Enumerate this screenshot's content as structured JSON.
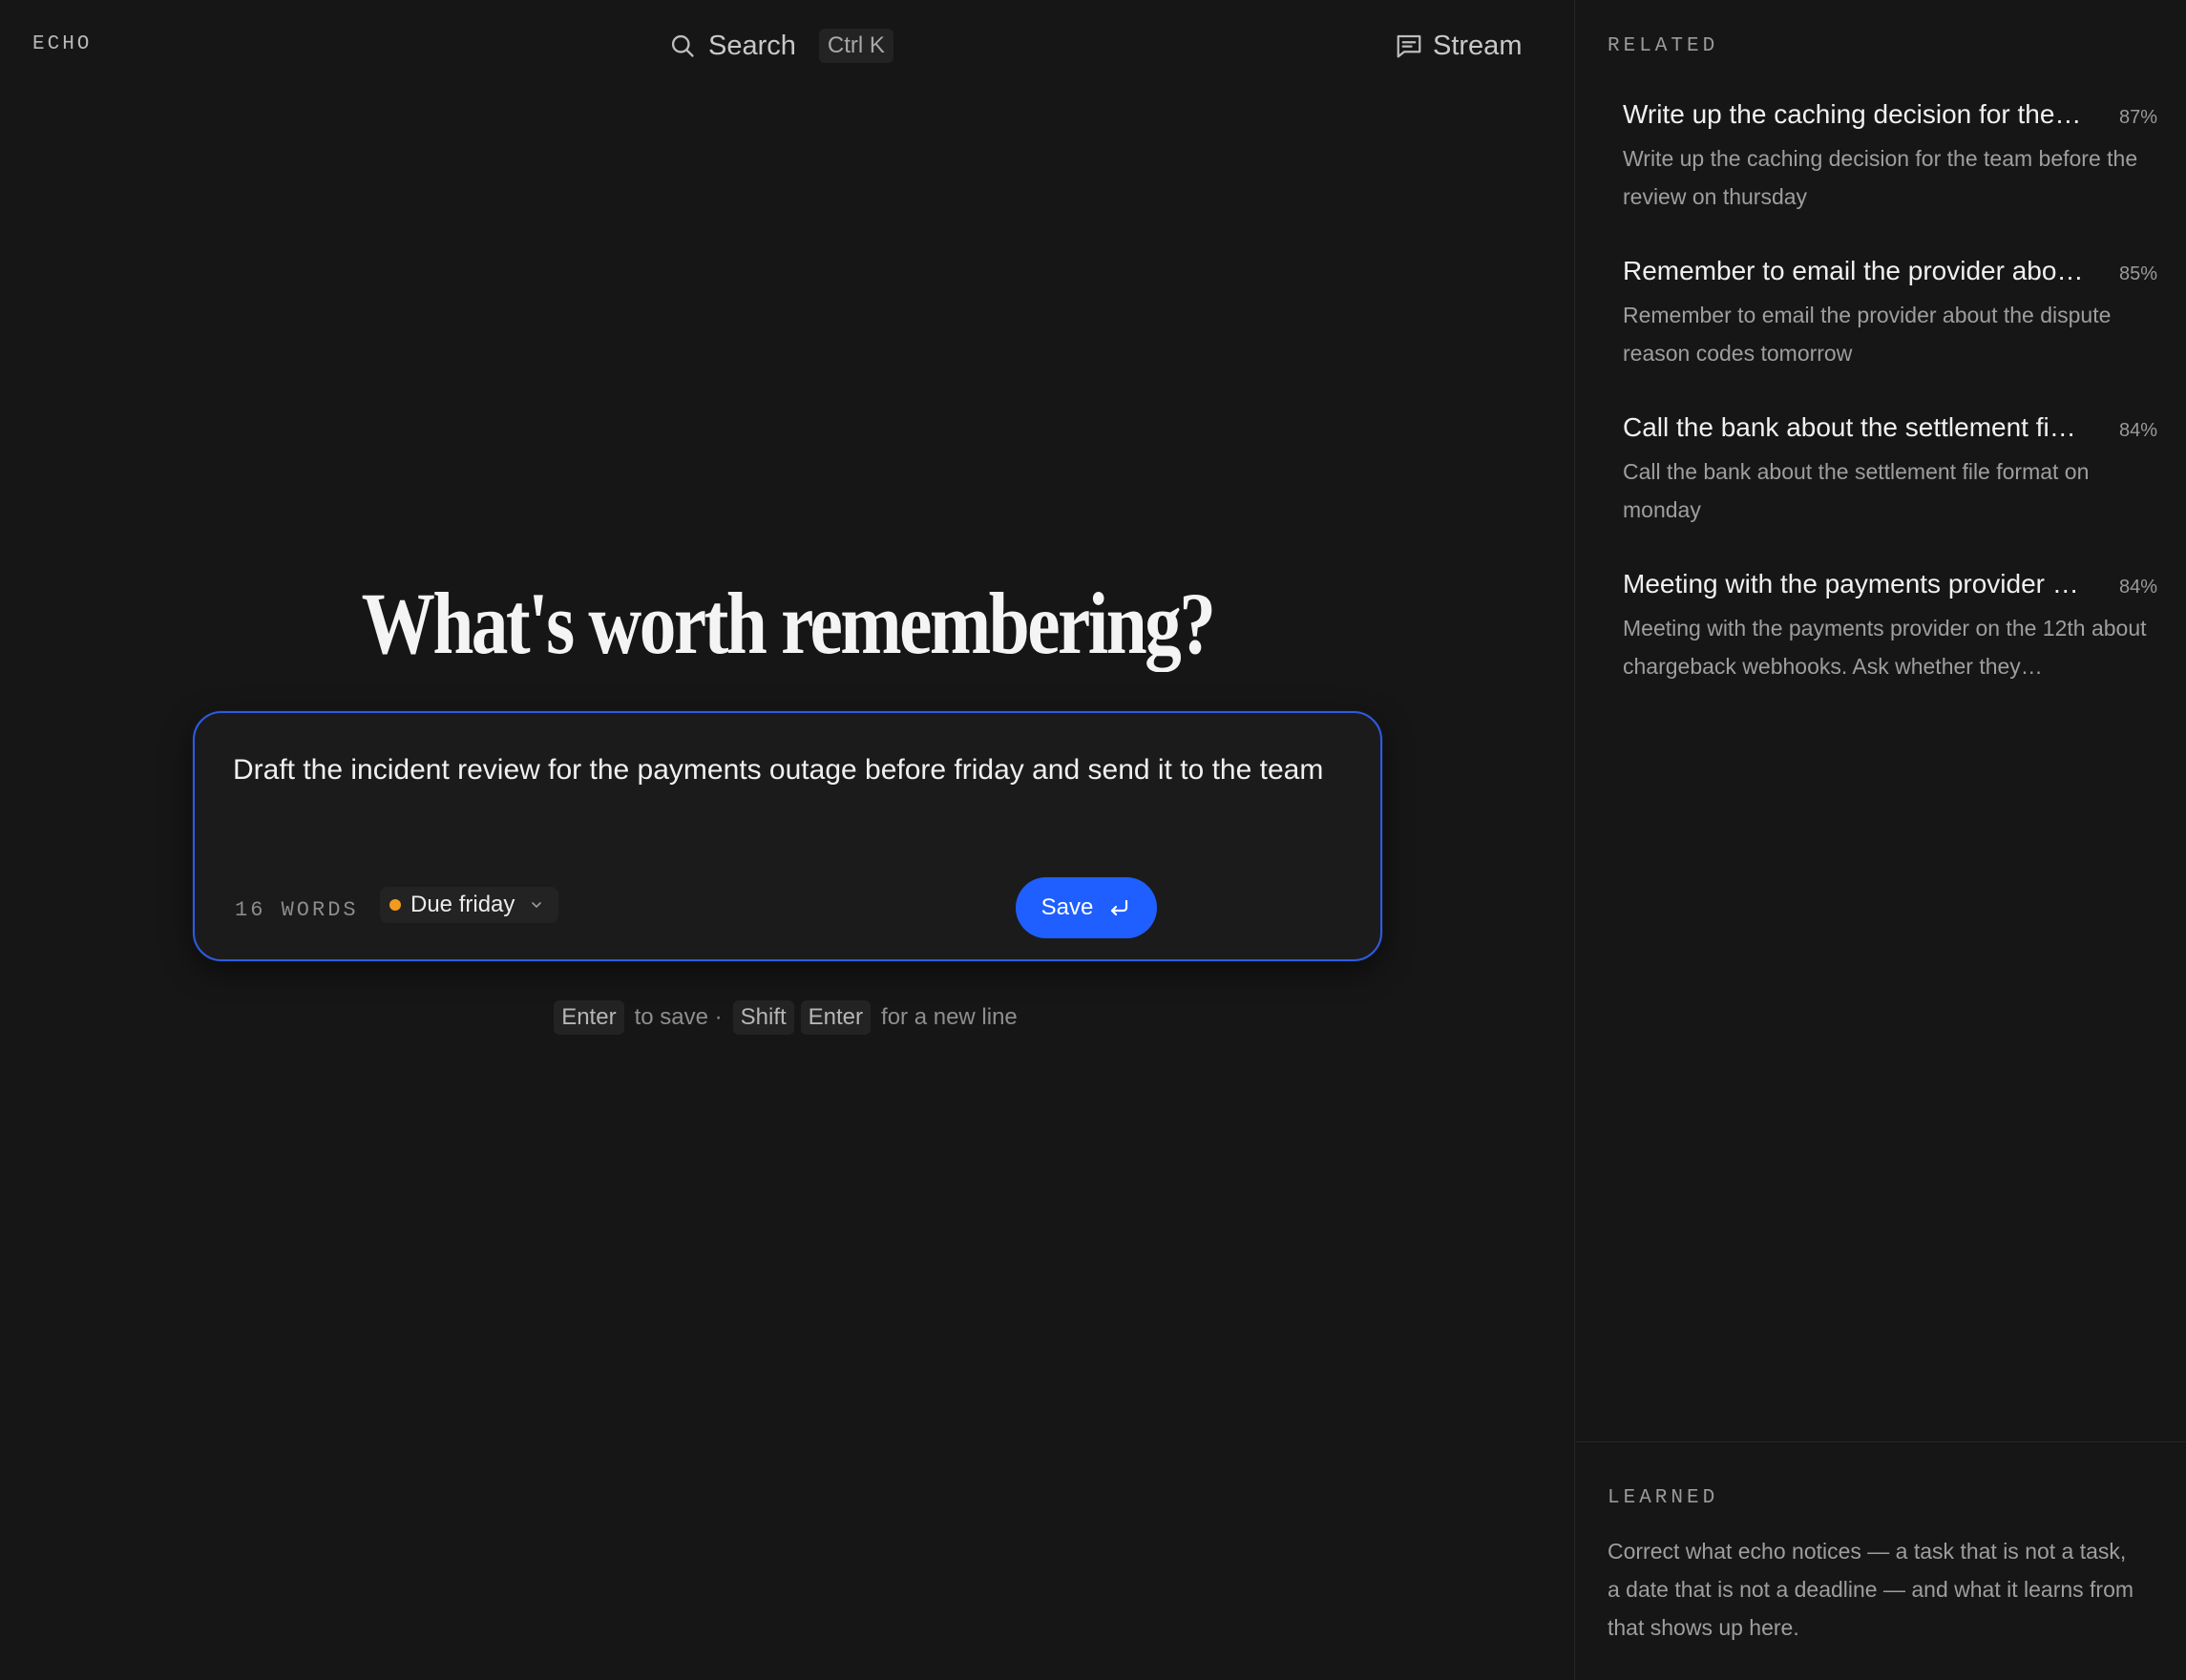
{
  "app": {
    "brand": "ECHO"
  },
  "header": {
    "search_label": "Search",
    "search_shortcut": "Ctrl K",
    "stream_label": "Stream"
  },
  "main": {
    "headline": "What's worth remembering?",
    "composer": {
      "text": "Draft the incident review for the payments outage before friday and send it to the team",
      "word_count": "16 WORDS",
      "due_label": "Due friday",
      "due_color": "#f29a1f",
      "save_label": "Save"
    },
    "hints": {
      "key_enter": "Enter",
      "to_save": "to save ·",
      "key_shift": "Shift",
      "key_enter2": "Enter",
      "new_line": "for a new line"
    }
  },
  "sidebar": {
    "related_title": "RELATED",
    "related": [
      {
        "title": "Write up the caching decision for the…",
        "score": "87%",
        "body": "Write up the caching decision for the team before the review on thursday"
      },
      {
        "title": "Remember to email the provider abo…",
        "score": "85%",
        "body": "Remember to email the provider about the dispute reason codes tomorrow"
      },
      {
        "title": "Call the bank about the settlement fi…",
        "score": "84%",
        "body": "Call the bank about the settlement file format on monday"
      },
      {
        "title": "Meeting with the payments provider …",
        "score": "84%",
        "body": "Meeting with the payments provider on the 12th about chargeback webhooks. Ask whether they…"
      }
    ],
    "learned_title": "LEARNED",
    "learned_text": "Correct what echo notices — a task that is not a task, a date that is not a deadline — and what it learns from that shows up here."
  },
  "colors": {
    "accent": "#1f5fff",
    "focus_border": "#2f5be0",
    "background": "#161616"
  }
}
